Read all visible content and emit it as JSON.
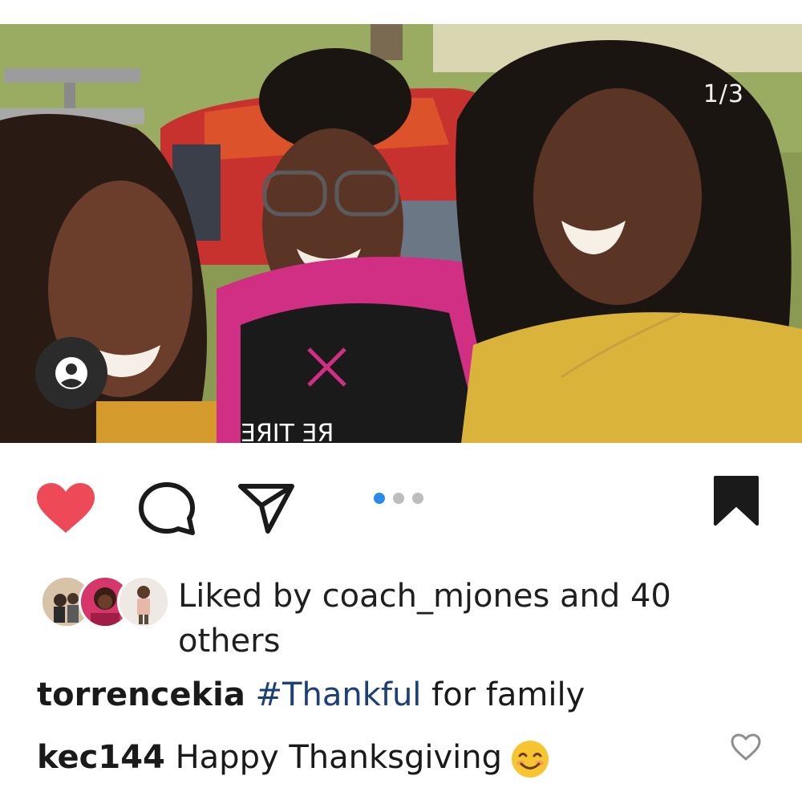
{
  "post": {
    "image_counter": "1/3",
    "image_alt": "Three women smiling together outdoors",
    "carousel": {
      "total": 3,
      "active": 1
    }
  },
  "actions": {
    "like_icon": "heart-filled-icon",
    "comment_icon": "comment-icon",
    "share_icon": "send-icon",
    "save_icon": "bookmark-filled-icon",
    "liked": true
  },
  "likes": {
    "text": "Liked by coach_mjones and 40 others"
  },
  "caption": {
    "username": "torrencekia",
    "hashtag": "#Thankful",
    "text": " for family"
  },
  "comment": {
    "username": "kec144",
    "text": " Happy Thanksgiving"
  },
  "colors": {
    "like_red": "#ed4956",
    "dot_active": "#2b8be8",
    "hashtag_blue": "#1c3f7a"
  }
}
